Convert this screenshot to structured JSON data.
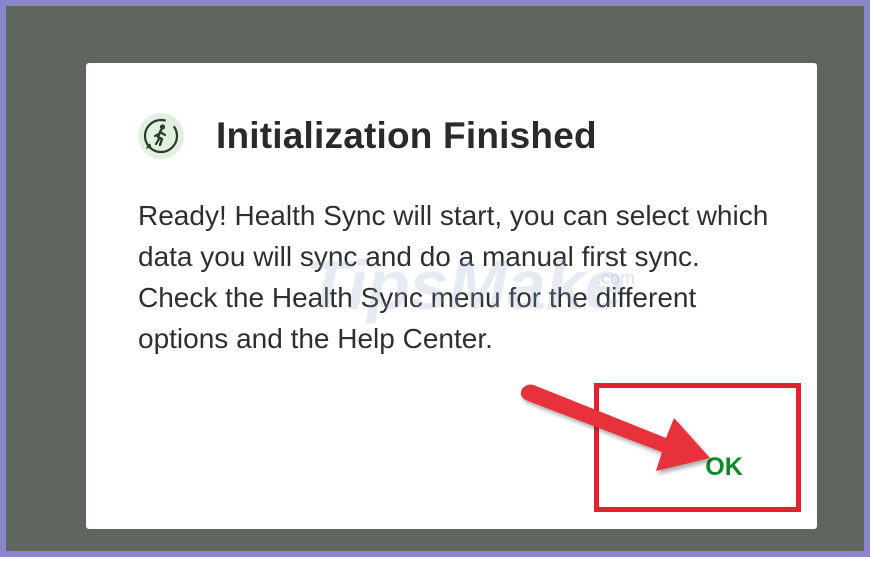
{
  "dialog": {
    "title": "Initialization Finished",
    "icon": "walking-person-icon",
    "message": "Ready! Health Sync will start, you can select which data you will sync and do a manual first sync. Check the Health Sync menu for the different options and the Help Center.",
    "ok_label": "OK"
  },
  "watermark": {
    "text": "TipsMake",
    "domain": ".com"
  },
  "annotation": {
    "arrow_color": "#e8303a",
    "box_color": "#e0232e"
  },
  "colors": {
    "backdrop": "#5f665f",
    "frame_border": "#8a86cc",
    "ok_text": "#0e8a2a",
    "icon_bg": "#e2f1df"
  }
}
